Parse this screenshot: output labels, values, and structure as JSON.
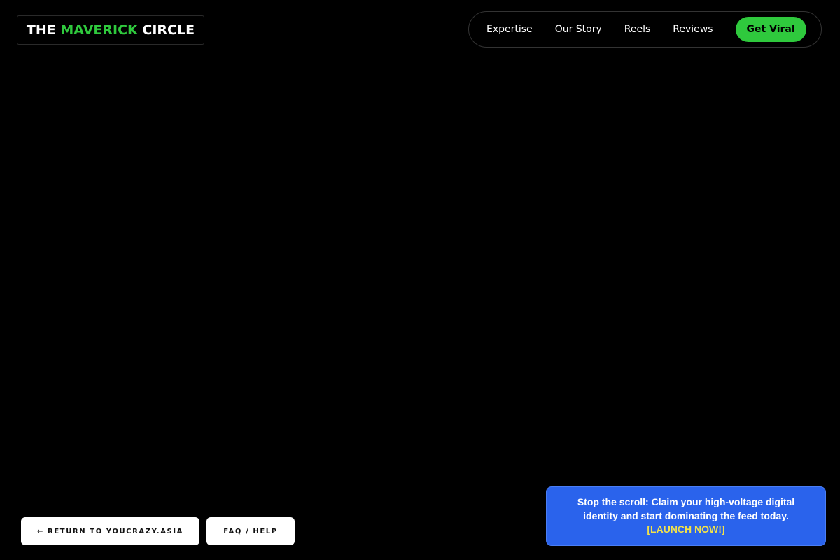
{
  "header": {
    "logo": {
      "prefix": "THE",
      "accent": "MAVERICK",
      "suffix": "CIRCLE"
    },
    "nav": {
      "items": [
        {
          "label": "Expertise"
        },
        {
          "label": "Our Story"
        },
        {
          "label": "Reels"
        },
        {
          "label": "Reviews"
        }
      ],
      "cta_label": "Get Viral"
    }
  },
  "footer_buttons": {
    "return_label": "← RETURN TO YOUCRAZY.ASIA",
    "faq_label": "FAQ / HELP"
  },
  "promo": {
    "text": "Stop the scroll: Claim your high-voltage digital identity and start dominating the feed today.",
    "link_label": "[LAUNCH NOW!]"
  },
  "colors": {
    "background": "#000000",
    "accent_green": "#2fc93d",
    "promo_blue": "#2a63ec",
    "promo_link_yellow": "#f2e24a"
  }
}
